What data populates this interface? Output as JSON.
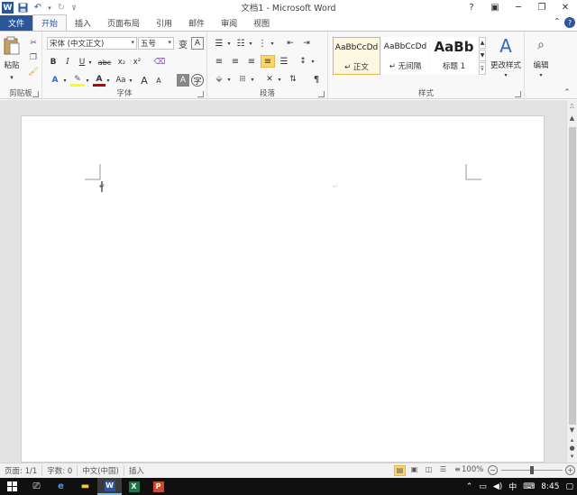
{
  "window": {
    "title": "文档1 - Microsoft Word",
    "app_icon": "W"
  },
  "tabs": [
    {
      "label": "文件",
      "name": "tab-file"
    },
    {
      "label": "开始",
      "name": "tab-home"
    },
    {
      "label": "插入",
      "name": "tab-insert"
    },
    {
      "label": "页面布局",
      "name": "tab-page-layout"
    },
    {
      "label": "引用",
      "name": "tab-references"
    },
    {
      "label": "邮件",
      "name": "tab-mailings"
    },
    {
      "label": "审阅",
      "name": "tab-review"
    },
    {
      "label": "视图",
      "name": "tab-view"
    }
  ],
  "ribbon": {
    "clipboard": {
      "label": "剪贴板",
      "paste_label": "粘贴"
    },
    "font": {
      "label": "字体",
      "font_name": "宋体 (中文正文)",
      "font_size": "五号",
      "bold": "B",
      "italic": "I",
      "underline": "U",
      "strike": "abc",
      "subscript": "x₂",
      "superscript": "x²",
      "grow": "A",
      "shrink": "A",
      "case": "Aa",
      "wen": "变",
      "clear_format": "A",
      "char_border": "A"
    },
    "paragraph": {
      "label": "段落"
    },
    "styles": {
      "label": "样式",
      "items": [
        {
          "sample": "AaBbCcDd",
          "name": "↵ 正文"
        },
        {
          "sample": "AaBbCcDd",
          "name": "↵ 无间隔"
        },
        {
          "sample": "AaBb",
          "name": "标题 1"
        }
      ],
      "change_styles": "更改样式"
    },
    "editing": {
      "label": "编辑"
    }
  },
  "statusbar": {
    "page": "页面: 1/1",
    "words": "字数: 0",
    "language": "中文(中国)",
    "mode": "插入",
    "zoom": "100%"
  },
  "taskbar": {
    "time": "8:45",
    "ime": "中",
    "apps": [
      {
        "name": "word",
        "letter": "W",
        "color": "#2b579a"
      },
      {
        "name": "excel",
        "letter": "X",
        "color": "#217346"
      },
      {
        "name": "powerpoint",
        "letter": "P",
        "color": "#d24726"
      }
    ]
  }
}
